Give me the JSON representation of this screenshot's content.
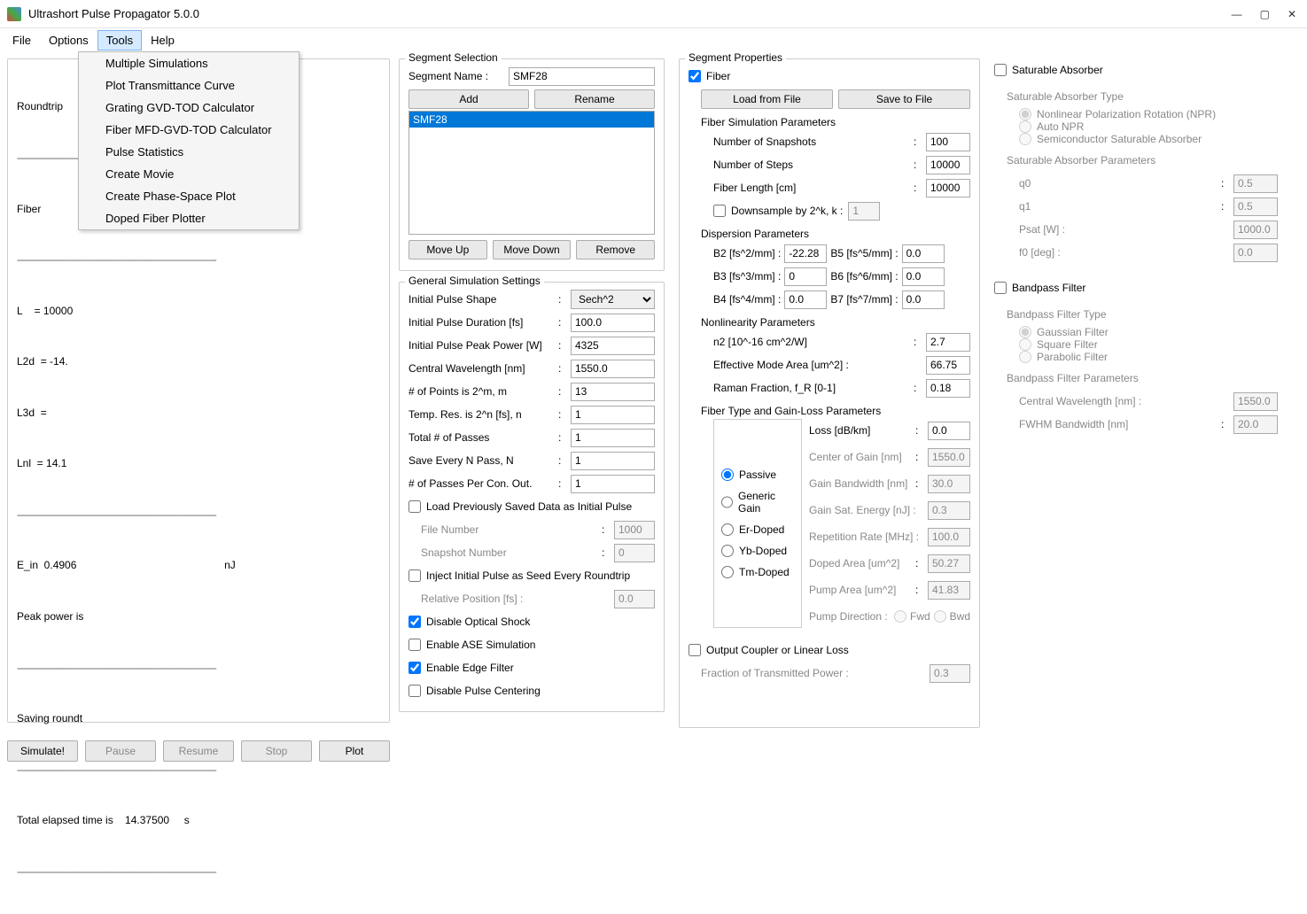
{
  "title": "Ultrashort Pulse Propagator 5.0.0",
  "menubar": [
    "File",
    "Options",
    "Tools",
    "Help"
  ],
  "tools_dropdown": [
    "Multiple Simulations",
    "Plot Transmittance Curve",
    "Grating GVD-TOD Calculator",
    "Fiber MFD-GVD-TOD Calculator",
    "Pulse Statistics",
    "Create Movie",
    "Create Phase-Space Plot",
    "Doped Fiber Plotter"
  ],
  "log": {
    "roundtrip": "Roundtrip",
    "fiber": "Fiber",
    "l1": "L    = 10000",
    "l2": "L2d  = -14.",
    "l3": "L3d  = ",
    "l4": "Lnl  = 14.1",
    "ein": "E_in  0.4906                                                  nJ",
    "peak": "Peak power is",
    "saving": "Saving roundt",
    "elapsed": "Total elapsed time is    14.37500     s"
  },
  "bottom_buttons": {
    "simulate": "Simulate!",
    "pause": "Pause",
    "resume": "Resume",
    "stop": "Stop",
    "plot": "Plot"
  },
  "segment_selection": {
    "title": "Segment Selection",
    "name_label": "Segment Name :",
    "name_value": "SMF28",
    "add": "Add",
    "rename": "Rename",
    "items": [
      "SMF28"
    ],
    "moveup": "Move Up",
    "movedown": "Move Down",
    "remove": "Remove"
  },
  "general": {
    "title": "General Simulation Settings",
    "shape_label": "Initial Pulse Shape",
    "shape_value": "Sech^2",
    "duration_label": "Initial Pulse Duration [fs]",
    "duration": "100.0",
    "power_label": "Initial Pulse Peak Power [W]",
    "power": "4325",
    "wavelength_label": "Central Wavelength [nm]",
    "wavelength": "1550.0",
    "points_label": "# of Points is 2^m, m",
    "points": "13",
    "tempres_label": "Temp. Res. is 2^n [fs], n",
    "tempres": "1",
    "passes_label": "Total # of Passes",
    "passes": "1",
    "saven_label": "Save Every N Pass, N",
    "saven": "1",
    "passescon_label": "# of Passes Per Con. Out.",
    "passescon": "1",
    "loadprev": "Load Previously Saved Data as Initial Pulse",
    "filenum_label": "File Number",
    "filenum": "1000",
    "snapnum_label": "Snapshot Number",
    "snapnum": "0",
    "inject": "Inject Initial Pulse as Seed Every Roundtrip",
    "relpos_label": "Relative Position [fs] :",
    "relpos": "0.0",
    "disable_shock": "Disable Optical Shock",
    "enable_ase": "Enable ASE Simulation",
    "enable_edge": "Enable Edge Filter",
    "disable_center": "Disable Pulse Centering"
  },
  "segprops": {
    "title": "Segment Properties",
    "fiber": "Fiber",
    "load": "Load from File",
    "save": "Save to File",
    "fsp": "Fiber Simulation Parameters",
    "snaps_label": "Number of Snapshots",
    "snaps": "100",
    "steps_label": "Number of Steps",
    "steps": "10000",
    "flen_label": "Fiber Length [cm]",
    "flen": "10000",
    "downsample": "Downsample by 2^k, k :",
    "downsample_val": "1",
    "disp": "Dispersion Parameters",
    "b2_label": "B2 [fs^2/mm] :",
    "b2": "-22.28",
    "b3_label": "B3 [fs^3/mm] :",
    "b3": "0",
    "b4_label": "B4 [fs^4/mm] :",
    "b4": "0.0",
    "b5_label": "B5 [fs^5/mm] :",
    "b5": "0.0",
    "b6_label": "B6 [fs^6/mm] :",
    "b6": "0.0",
    "b7_label": "B7 [fs^7/mm] :",
    "b7": "0.0",
    "nonlin": "Nonlinearity Parameters",
    "n2_label": "n2 [10^-16 cm^2/W]",
    "n2": "2.7",
    "ema_label": "Effective Mode Area [um^2] :",
    "ema": "66.75",
    "raman_label": "Raman Fraction, f_R [0-1]",
    "raman": "0.18",
    "ftype": "Fiber Type and Gain-Loss Parameters",
    "radio": [
      "Passive",
      "Generic Gain",
      "Er-Doped",
      "Yb-Doped",
      "Tm-Doped"
    ],
    "loss_label": "Loss [dB/km]",
    "loss": "0.0",
    "cog_label": "Center of Gain [nm]",
    "cog": "1550.0",
    "gbw_label": "Gain Bandwidth [nm]",
    "gbw": "30.0",
    "gse_label": "Gain Sat. Energy [nJ] :",
    "gse": "0.3",
    "rr_label": "Repetition Rate [MHz] :",
    "rr": "100.0",
    "da_label": "Doped Area [um^2]",
    "da": "50.27",
    "pa_label": "Pump Area [um^2]",
    "pa": "41.83",
    "pd_label": "Pump Direction :",
    "fwd": "Fwd",
    "bwd": "Bwd",
    "oc": "Output Coupler or Linear Loss",
    "ftp_label": "Fraction of Transmitted Power :",
    "ftp": "0.3"
  },
  "sa": {
    "title": "Saturable Absorber",
    "type": "Saturable Absorber Type",
    "opts": [
      "Nonlinear Polarization Rotation (NPR)",
      "Auto NPR",
      "Semiconductor Saturable Absorber"
    ],
    "params": "Saturable Absorber Parameters",
    "q0_label": "q0",
    "q0": "0.5",
    "q1_label": "q1",
    "q1": "0.5",
    "psat_label": "Psat [W] :",
    "psat": "1000.0",
    "f0_label": "f0 [deg] :",
    "f0": "0.0"
  },
  "bp": {
    "title": "Bandpass Filter",
    "type": "Bandpass Filter Type",
    "opts": [
      "Gaussian Filter",
      "Square Filter",
      "Parabolic Filter"
    ],
    "params": "Bandpass Filter Parameters",
    "cw_label": "Central Wavelength [nm] :",
    "cw": "1550.0",
    "fwhm_label": "FWHM Bandwidth [nm]",
    "fwhm": "20.0"
  }
}
